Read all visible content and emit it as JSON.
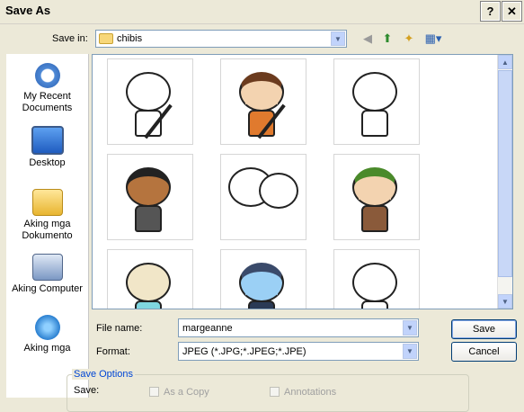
{
  "window": {
    "title": "Save As",
    "help_label": "?",
    "close_label": "✕"
  },
  "toolbar": {
    "save_in_label": "Save in:",
    "save_in_value": "chibis",
    "icons": [
      "back-icon",
      "up-folder-icon",
      "new-folder-icon",
      "views-menu-icon"
    ]
  },
  "places": [
    {
      "label": "My Recent Documents",
      "icon": "recent-documents-icon"
    },
    {
      "label": "Desktop",
      "icon": "desktop-icon"
    },
    {
      "label": "Aking mga Dokumento",
      "icon": "my-documents-icon"
    },
    {
      "label": "Aking Computer",
      "icon": "my-computer-icon"
    },
    {
      "label": "Aking mga",
      "icon": "network-places-icon"
    }
  ],
  "file_name": {
    "label": "File name:",
    "value": "margeanne"
  },
  "format": {
    "label": "Format:",
    "value": "JPEG (*.JPG;*.JPEG;*.JPE)"
  },
  "buttons": {
    "save": "Save",
    "cancel": "Cancel"
  },
  "save_options": {
    "title": "Save Options",
    "save_label": "Save:",
    "as_a_copy": "As a Copy",
    "annotations": "Annotations"
  },
  "colors": {
    "link_blue": "#0046d5",
    "dialog_bg": "#ece9d8"
  }
}
